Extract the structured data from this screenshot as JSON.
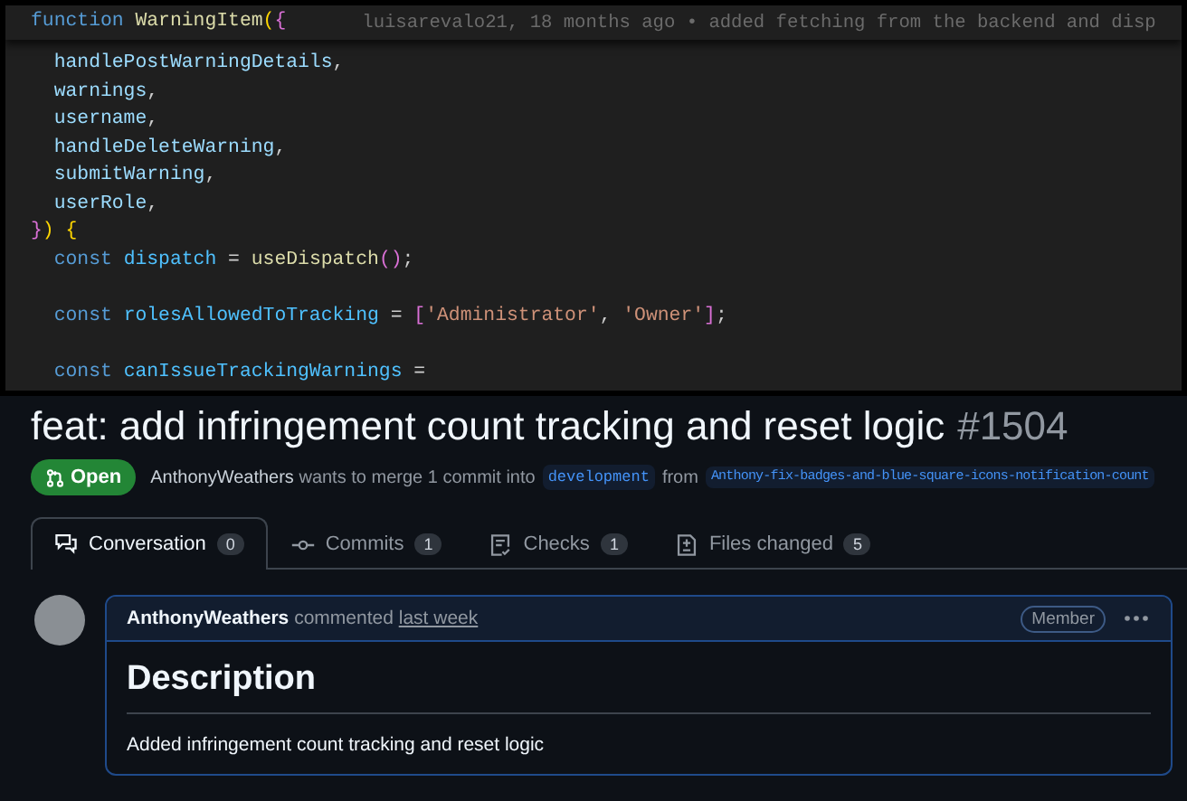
{
  "editor": {
    "sticky_line": {
      "tokens": [
        {
          "t": "function ",
          "kind": "kw"
        },
        {
          "t": "WarningItem",
          "kind": "fn"
        },
        {
          "t": "(",
          "kind": "b1"
        },
        {
          "t": "{",
          "kind": "b2"
        }
      ]
    },
    "blame": "luisarevalo21, 18 months ago • added fetching from the backend and disp",
    "lines": [
      {
        "kind": "code",
        "tokens": [
          {
            "t": "  handlePostWarningDetails",
            "kind": "var"
          },
          {
            "t": ",",
            "kind": "p"
          }
        ]
      },
      {
        "kind": "code",
        "tokens": [
          {
            "t": "  warnings",
            "kind": "var"
          },
          {
            "t": ",",
            "kind": "p"
          }
        ]
      },
      {
        "kind": "code",
        "tokens": [
          {
            "t": "  username",
            "kind": "var"
          },
          {
            "t": ",",
            "kind": "p"
          }
        ]
      },
      {
        "kind": "code",
        "tokens": [
          {
            "t": "  handleDeleteWarning",
            "kind": "var"
          },
          {
            "t": ",",
            "kind": "p"
          }
        ]
      },
      {
        "kind": "code",
        "tokens": [
          {
            "t": "  submitWarning",
            "kind": "var"
          },
          {
            "t": ",",
            "kind": "p"
          }
        ]
      },
      {
        "kind": "code",
        "tokens": [
          {
            "t": "  userRole",
            "kind": "var"
          },
          {
            "t": ",",
            "kind": "p"
          }
        ]
      },
      {
        "kind": "code",
        "tokens": [
          {
            "t": "}",
            "kind": "b2"
          },
          {
            "t": ")",
            "kind": "b1"
          },
          {
            "t": " {",
            "kind": "b1"
          }
        ]
      },
      {
        "kind": "code",
        "tokens": [
          {
            "t": "  const ",
            "kind": "kw"
          },
          {
            "t": "dispatch",
            "kind": "cv"
          },
          {
            "t": " = ",
            "kind": "p"
          },
          {
            "t": "useDispatch",
            "kind": "fn"
          },
          {
            "t": "()",
            "kind": "b2"
          },
          {
            "t": ";",
            "kind": "p"
          }
        ]
      },
      {
        "kind": "blank"
      },
      {
        "kind": "code",
        "tokens": [
          {
            "t": "  const ",
            "kind": "kw"
          },
          {
            "t": "rolesAllowedToTracking",
            "kind": "cv"
          },
          {
            "t": " = ",
            "kind": "p"
          },
          {
            "t": "[",
            "kind": "b2"
          },
          {
            "t": "'Administrator'",
            "kind": "str"
          },
          {
            "t": ", ",
            "kind": "p"
          },
          {
            "t": "'Owner'",
            "kind": "str"
          },
          {
            "t": "]",
            "kind": "b2"
          },
          {
            "t": ";",
            "kind": "p"
          }
        ]
      },
      {
        "kind": "blank"
      },
      {
        "kind": "code",
        "tokens": [
          {
            "t": "  const ",
            "kind": "kw"
          },
          {
            "t": "canIssueTrackingWarnings",
            "kind": "cv"
          },
          {
            "t": " =",
            "kind": "p"
          }
        ]
      }
    ]
  },
  "pull_request": {
    "title": "feat: add infringement count tracking and reset logic",
    "number": "#1504",
    "state": {
      "label": "Open"
    },
    "author": "AnthonyWeathers",
    "merge_text": "wants to merge 1 commit into",
    "base_branch": "development",
    "from_text": "from",
    "head_branch": "Anthony-fix-badges-and-blue-square-icons-notification-count",
    "tabs": [
      {
        "label": "Conversation",
        "count": "0",
        "selected": true
      },
      {
        "label": "Commits",
        "count": "1",
        "selected": false
      },
      {
        "label": "Checks",
        "count": "1",
        "selected": false
      },
      {
        "label": "Files changed",
        "count": "5",
        "selected": false
      }
    ],
    "comment": {
      "author": "AnthonyWeathers",
      "action": "commented",
      "time": "last week",
      "badge": "Member",
      "heading": "Description",
      "body": "Added infringement count tracking and reset logic"
    }
  }
}
